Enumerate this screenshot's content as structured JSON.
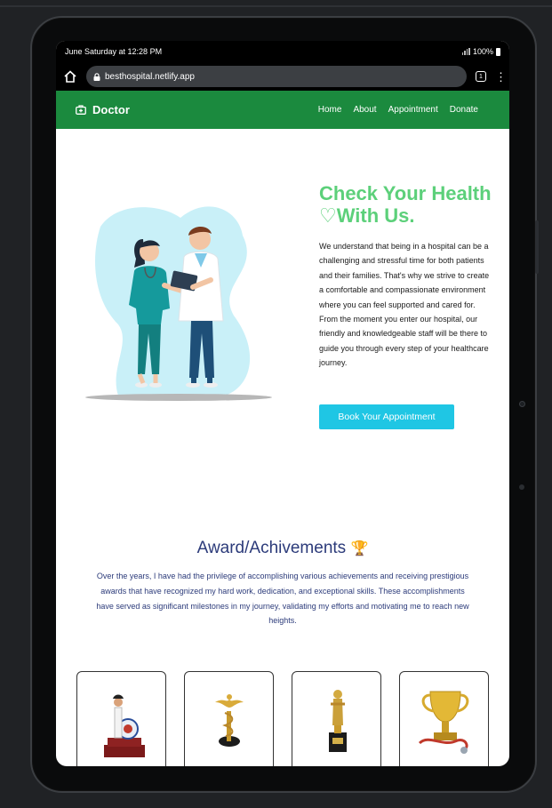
{
  "status_bar": {
    "time": "June Saturday at 12:28 PM",
    "battery": "100%"
  },
  "browser": {
    "url": "besthospital.netlify.app",
    "tab_count": "1"
  },
  "navbar": {
    "brand": "Doctor",
    "links": [
      "Home",
      "About",
      "Appointment",
      "Donate"
    ]
  },
  "hero": {
    "title_line1": "Check Your Health",
    "title_line2": "With Us.",
    "heart": "♡",
    "description": "We understand that being in a hospital can be a challenging and stressful time for both patients and their families. That's why we strive to create a comfortable and compassionate environment where you can feel supported and cared for. From the moment you enter our hospital, our friendly and knowledgeable staff will be there to guide you through every step of your healthcare journey.",
    "button": "Book Your Appointment"
  },
  "awards": {
    "title": "Award/Achivements",
    "trophy": "🏆",
    "description": "Over the years, I have had the privilege of accomplishing various achievements and receiving prestigious awards that have recognized my hard work, dedication, and exceptional skills. These accomplishments have served as significant milestones in my journey, validating my efforts and motivating me to reach new heights.",
    "cards": [
      "doctor-statue-trophy",
      "caduceus-trophy",
      "oscar-statue-trophy",
      "gold-cup-stethoscope-trophy"
    ]
  },
  "colors": {
    "nav_green": "#1b8a3e",
    "title_green": "#5cd07a",
    "button_cyan": "#1fc6e4",
    "heading_navy": "#2c3b7a"
  }
}
